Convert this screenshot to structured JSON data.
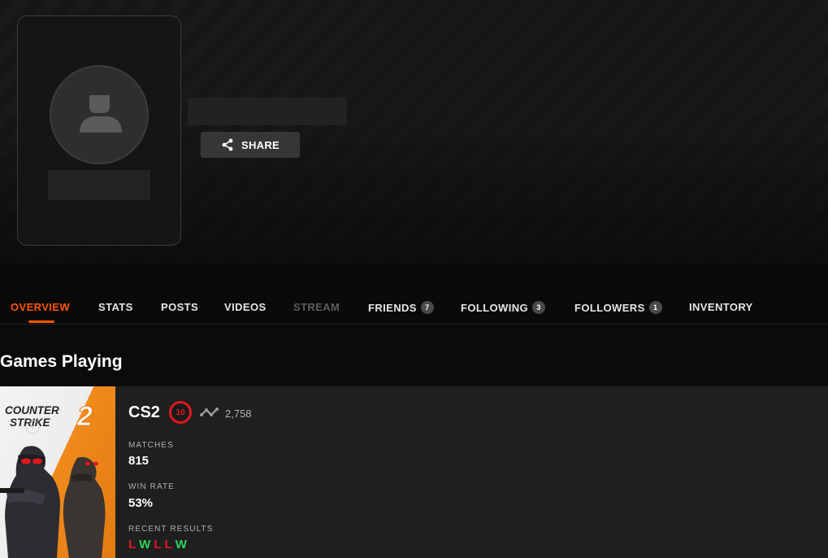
{
  "profile": {
    "share_label": "SHARE"
  },
  "tabs": [
    {
      "label": "OVERVIEW",
      "state": "active"
    },
    {
      "label": "STATS"
    },
    {
      "label": "POSTS"
    },
    {
      "label": "VIDEOS"
    },
    {
      "label": "STREAM",
      "state": "disabled"
    },
    {
      "label": "FRIENDS",
      "count": "7"
    },
    {
      "label": "FOLLOWING",
      "count": "3"
    },
    {
      "label": "FOLLOWERS",
      "count": "1"
    },
    {
      "label": "INVENTORY"
    }
  ],
  "games_section": {
    "title": "Games Playing"
  },
  "game": {
    "art_logo_line1": "COUNTER",
    "art_logo_line2": "STRIKE",
    "art_logo_number": "2",
    "name": "CS2",
    "level": "10",
    "elo": "2,758",
    "matches_label": "MATCHES",
    "matches": "815",
    "win_rate_label": "WIN RATE",
    "win_rate": "53%",
    "recent_label": "RECENT RESULTS",
    "recent_results": [
      "L",
      "W",
      "L",
      "L",
      "W"
    ]
  },
  "colors": {
    "accent": "#ff5500",
    "loss": "#e0181e",
    "win": "#2fd35a",
    "level_ring": "#e0181e"
  },
  "icons": {
    "share": "share-icon",
    "avatar": "user-silhouette-icon",
    "elo": "elo-graph-icon"
  }
}
